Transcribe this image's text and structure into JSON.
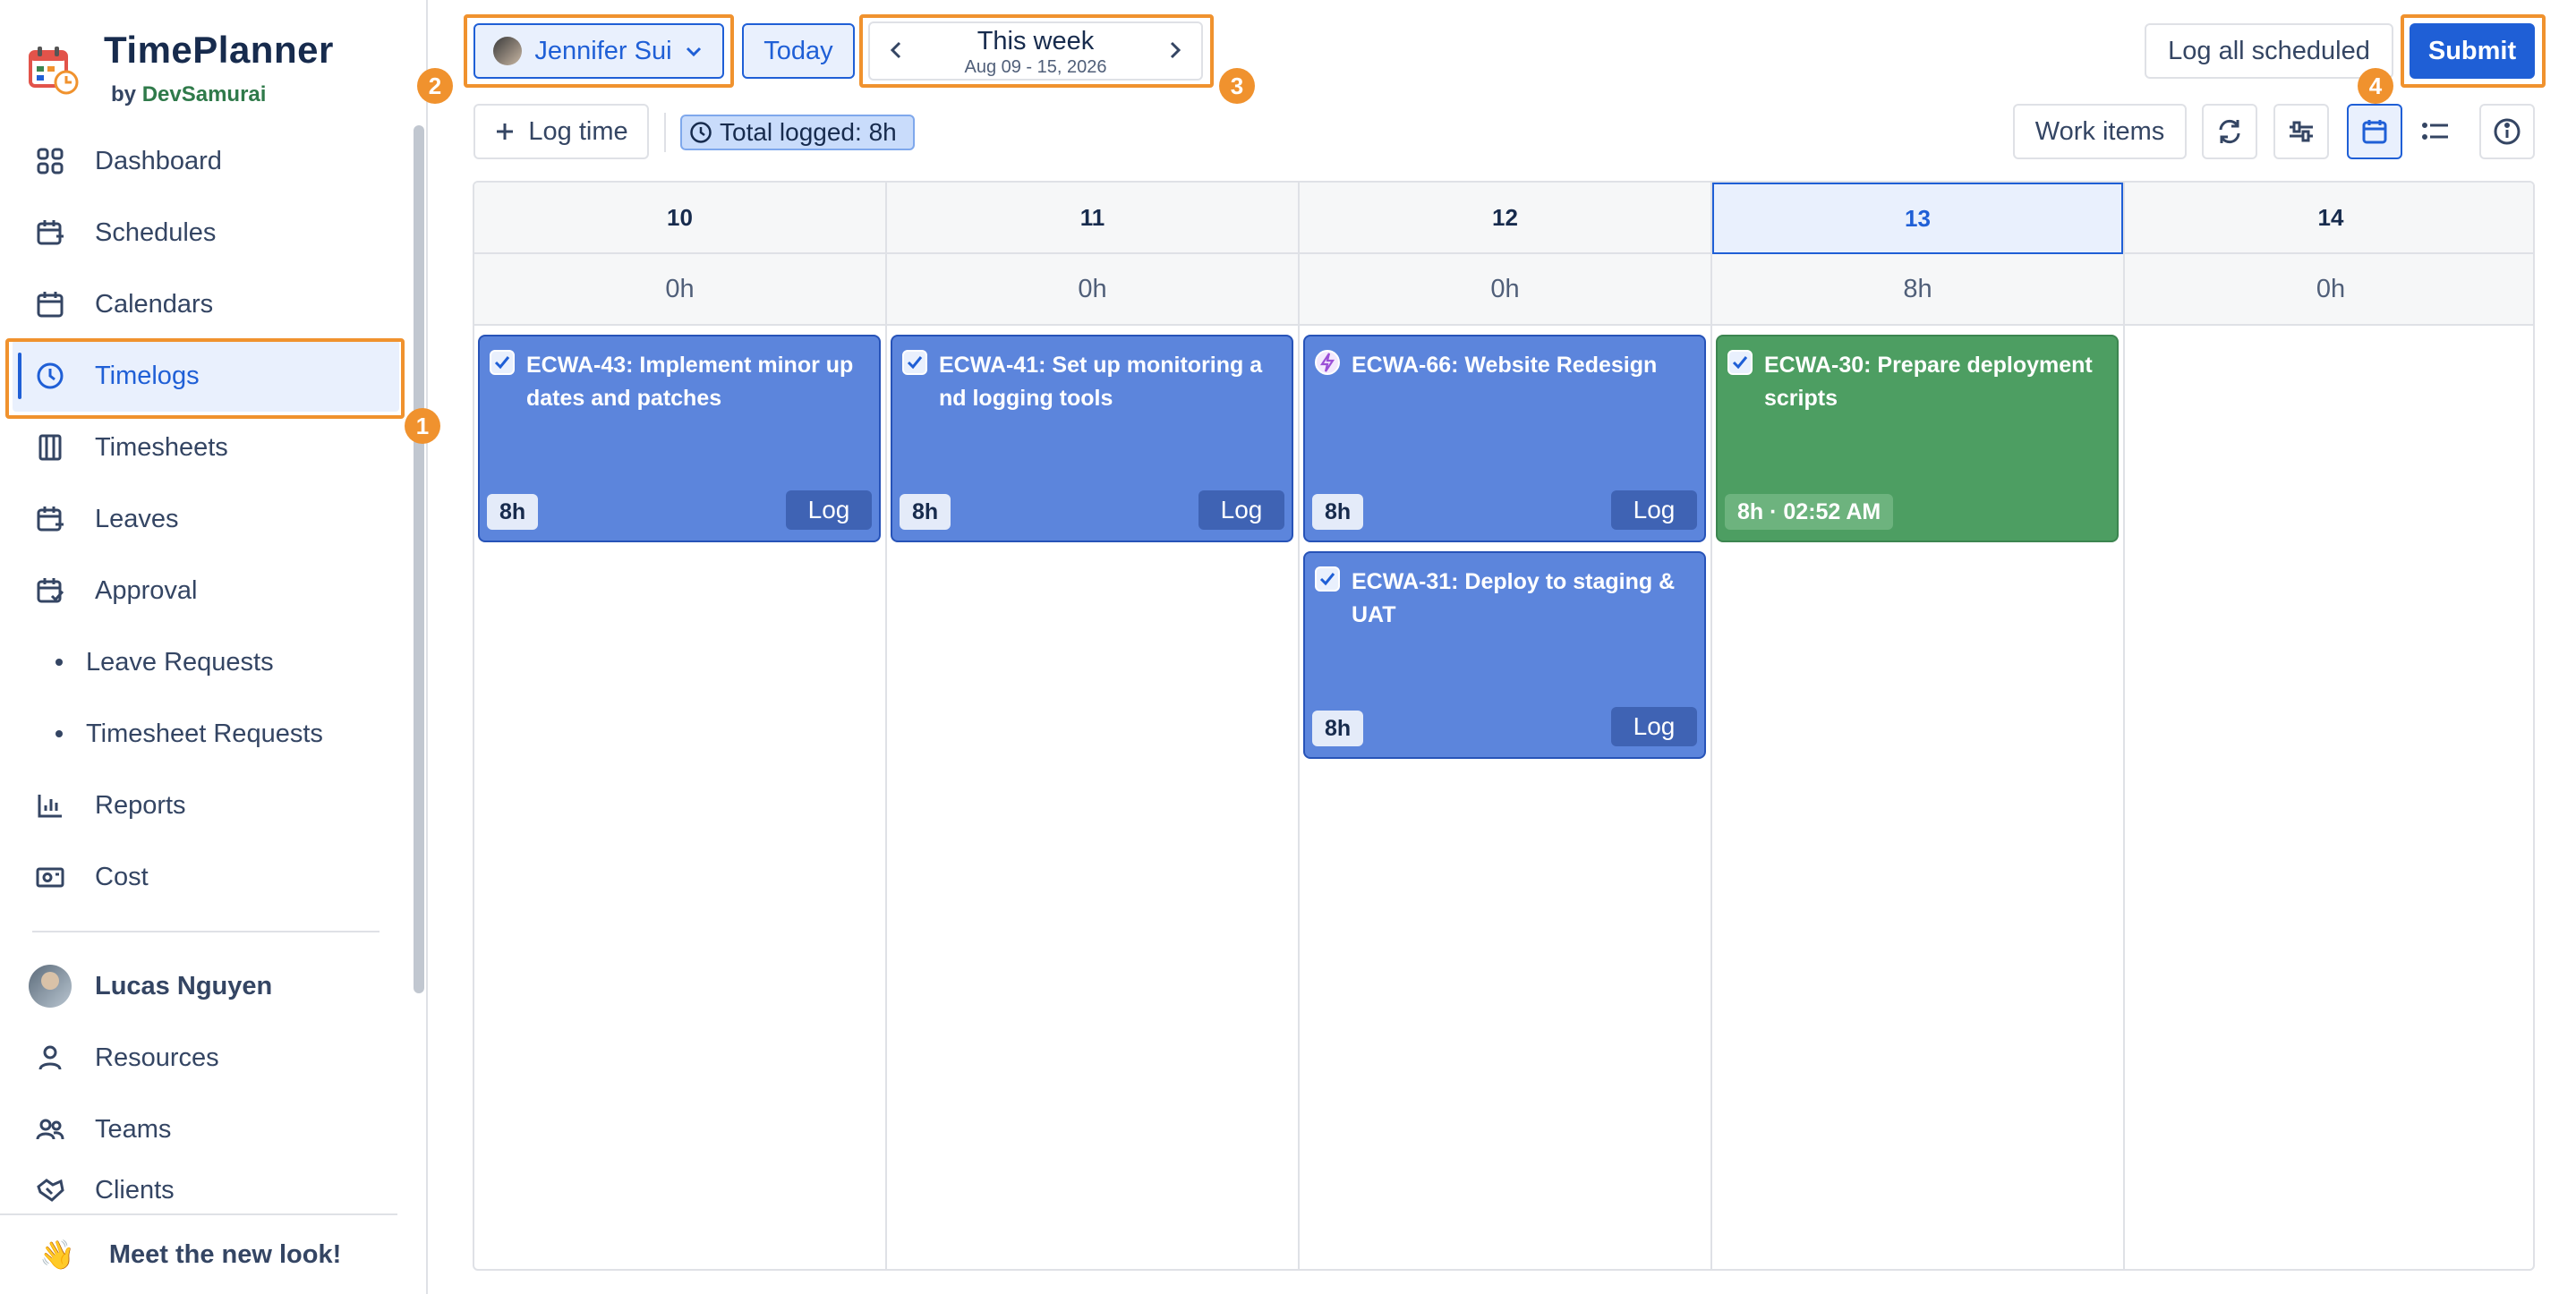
{
  "app": {
    "title": "TimePlanner",
    "by": "by",
    "company": "DevSamurai"
  },
  "sidebar": {
    "items": [
      {
        "label": "Dashboard",
        "icon": "grid-icon"
      },
      {
        "label": "Schedules",
        "icon": "calendar-plus-icon"
      },
      {
        "label": "Calendars",
        "icon": "calendar-icon"
      },
      {
        "label": "Timelogs",
        "icon": "clock-icon",
        "active": true
      },
      {
        "label": "Timesheets",
        "icon": "columns-icon"
      },
      {
        "label": "Leaves",
        "icon": "calendar-minus-icon"
      },
      {
        "label": "Approval",
        "icon": "calendar-check-icon"
      }
    ],
    "sub_items": [
      "Leave Requests",
      "Timesheet Requests"
    ],
    "items2": [
      {
        "label": "Reports",
        "icon": "bar-chart-icon"
      },
      {
        "label": "Cost",
        "icon": "money-icon"
      }
    ],
    "user": "Lucas Nguyen",
    "items3": [
      {
        "label": "Resources",
        "icon": "person-icon"
      },
      {
        "label": "Teams",
        "icon": "people-icon"
      },
      {
        "label": "Clients",
        "icon": "handshake-icon"
      }
    ],
    "meet": "Meet the new look!",
    "meet_emoji": "👋"
  },
  "toolbar": {
    "user_select": "Jennifer Sui",
    "today": "Today",
    "period_title": "This week",
    "period_range": "Aug 09 - 15, 2026",
    "log_all": "Log all scheduled",
    "submit": "Submit",
    "log_time": "Log time",
    "total_logged": "Total logged: 8h",
    "work_items": "Work items"
  },
  "steps": [
    "1",
    "2",
    "3",
    "4"
  ],
  "calendar": {
    "days": [
      {
        "day": "10",
        "hours": "0h"
      },
      {
        "day": "11",
        "hours": "0h"
      },
      {
        "day": "12",
        "hours": "0h"
      },
      {
        "day": "13",
        "hours": "8h",
        "today": true
      },
      {
        "day": "14",
        "hours": "0h"
      }
    ],
    "cards": [
      {
        "title": "ECWA-43: Implement minor updates and patches",
        "badge": "8h",
        "action": "Log",
        "type": "task"
      },
      {
        "title": "ECWA-41: Set up monitoring and logging tools",
        "badge": "8h",
        "action": "Log",
        "type": "task"
      },
      {
        "title": "ECWA-66: Website Redesign",
        "badge": "8h",
        "action": "Log",
        "type": "epic"
      },
      {
        "title": "ECWA-31: Deploy to staging & UAT",
        "badge": "8h",
        "action": "Log",
        "type": "task"
      },
      {
        "title": "ECWA-30: Prepare deployment scripts",
        "badge": "8h · 02:52 AM",
        "action": "",
        "type": "task"
      }
    ]
  },
  "colors": {
    "accent": "#1f5fd6",
    "card_blue": "#5c85dc",
    "card_green": "#4d9e62",
    "highlight": "#f0922e"
  }
}
